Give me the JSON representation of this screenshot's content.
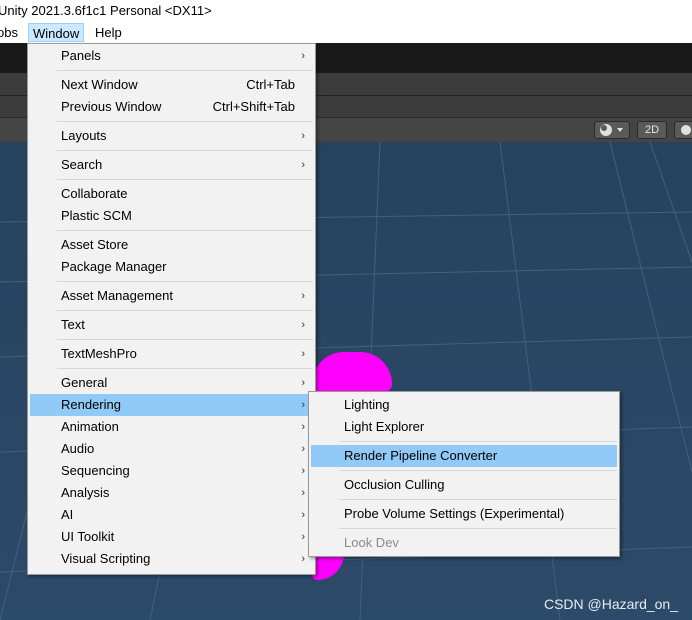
{
  "title_bar": {
    "text": "Unity 2021.3.6f1c1 Personal <DX11>"
  },
  "menu_bar": {
    "items": [
      {
        "label": "obs"
      },
      {
        "label": "Window"
      },
      {
        "label": "Help"
      }
    ]
  },
  "toolbar": {
    "mode_2d": "2D"
  },
  "window_menu": {
    "items": [
      {
        "label": "Panels",
        "arrow": "›"
      },
      {
        "label": "Next Window",
        "shortcut": "Ctrl+Tab"
      },
      {
        "label": "Previous Window",
        "shortcut": "Ctrl+Shift+Tab"
      },
      {
        "label": "Layouts",
        "arrow": "›"
      },
      {
        "label": "Search",
        "arrow": "›"
      },
      {
        "label": "Collaborate"
      },
      {
        "label": "Plastic SCM"
      },
      {
        "label": "Asset Store"
      },
      {
        "label": "Package Manager"
      },
      {
        "label": "Asset Management",
        "arrow": "›"
      },
      {
        "label": "Text",
        "arrow": "›"
      },
      {
        "label": "TextMeshPro",
        "arrow": "›"
      },
      {
        "label": "General",
        "arrow": "›"
      },
      {
        "label": "Rendering",
        "arrow": "›"
      },
      {
        "label": "Animation",
        "arrow": "›"
      },
      {
        "label": "Audio",
        "arrow": "›"
      },
      {
        "label": "Sequencing",
        "arrow": "›"
      },
      {
        "label": "Analysis",
        "arrow": "›"
      },
      {
        "label": "AI",
        "arrow": "›"
      },
      {
        "label": "UI Toolkit",
        "arrow": "›"
      },
      {
        "label": "Visual Scripting",
        "arrow": "›"
      }
    ]
  },
  "rendering_submenu": {
    "items": [
      {
        "label": "Lighting"
      },
      {
        "label": "Light Explorer"
      },
      {
        "label": "Render Pipeline Converter"
      },
      {
        "label": "Occlusion Culling"
      },
      {
        "label": "Probe Volume Settings (Experimental)"
      },
      {
        "label": "Look Dev"
      }
    ]
  },
  "watermark": "CSDN @Hazard_on_",
  "colors": {
    "highlight": "#91c9f7",
    "scene_background": "#2c4a69",
    "magenta_object": "#ff00ff"
  }
}
